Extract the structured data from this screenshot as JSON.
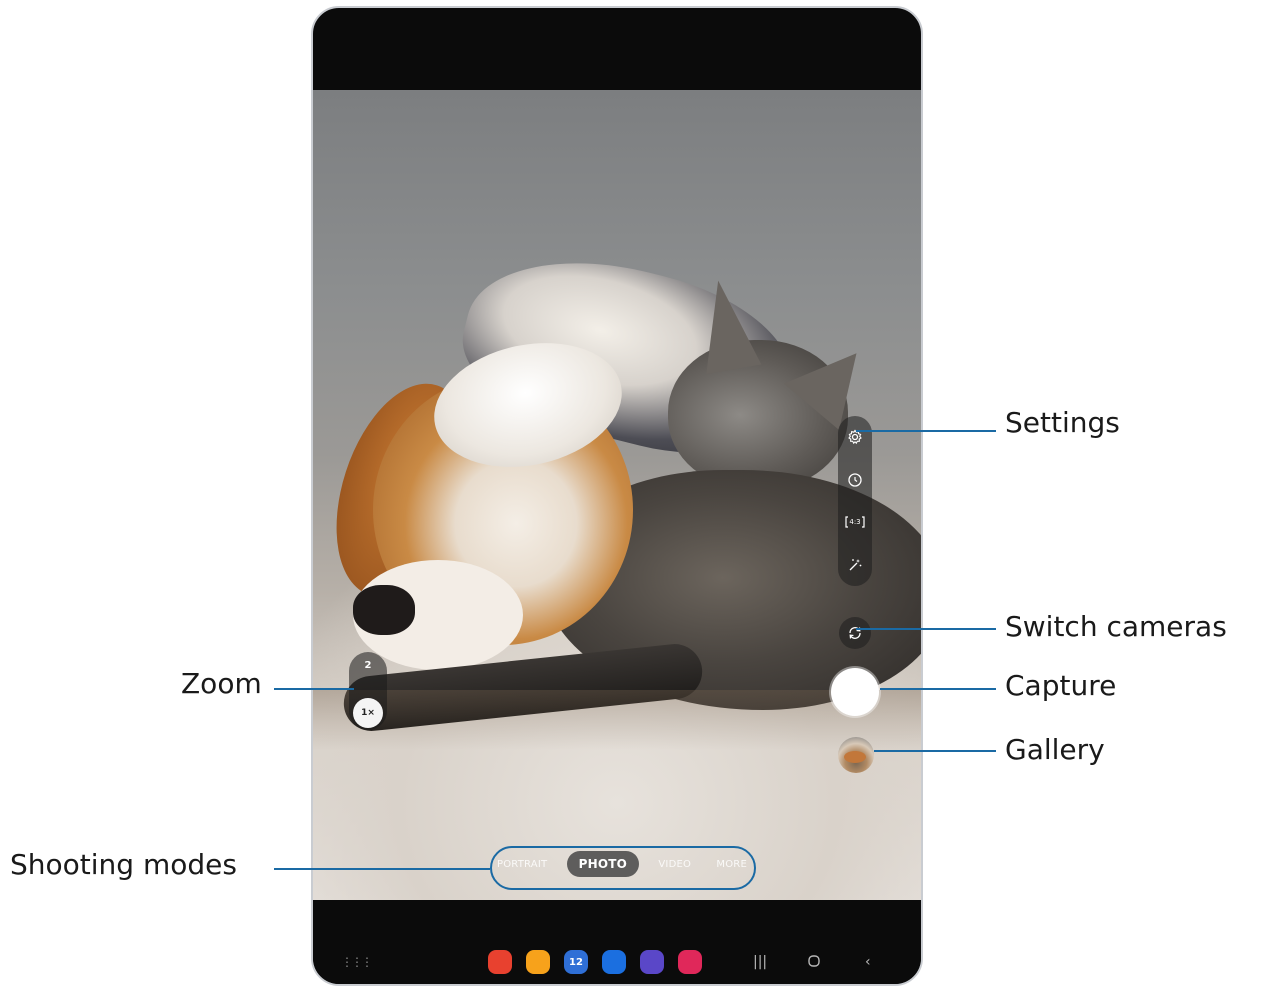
{
  "zoom": {
    "level_2": "2",
    "level_1": "1×"
  },
  "side_controls": [
    "settings-icon",
    "timer-icon",
    "aspect-ratio-icon",
    "effects-icon"
  ],
  "aspect_ratio_text": "4:3",
  "shooting_modes": [
    "PORTRAIT",
    "PHOTO",
    "VIDEO",
    "MORE"
  ],
  "active_mode": "PHOTO",
  "dock_apps": [
    {
      "name": "app-red",
      "color": "#e8412f"
    },
    {
      "name": "app-folder",
      "color": "#f7a21b"
    },
    {
      "name": "app-calendar",
      "color": "#2f6fd6",
      "label": "12"
    },
    {
      "name": "app-messages",
      "color": "#1b6fe0"
    },
    {
      "name": "app-internet",
      "color": "#5a47c8"
    },
    {
      "name": "app-camera",
      "color": "#e0285a"
    }
  ],
  "callouts": {
    "settings": "Settings",
    "switch_cameras": "Switch cameras",
    "capture": "Capture",
    "gallery": "Gallery",
    "zoom": "Zoom",
    "shooting_modes": "Shooting modes"
  }
}
